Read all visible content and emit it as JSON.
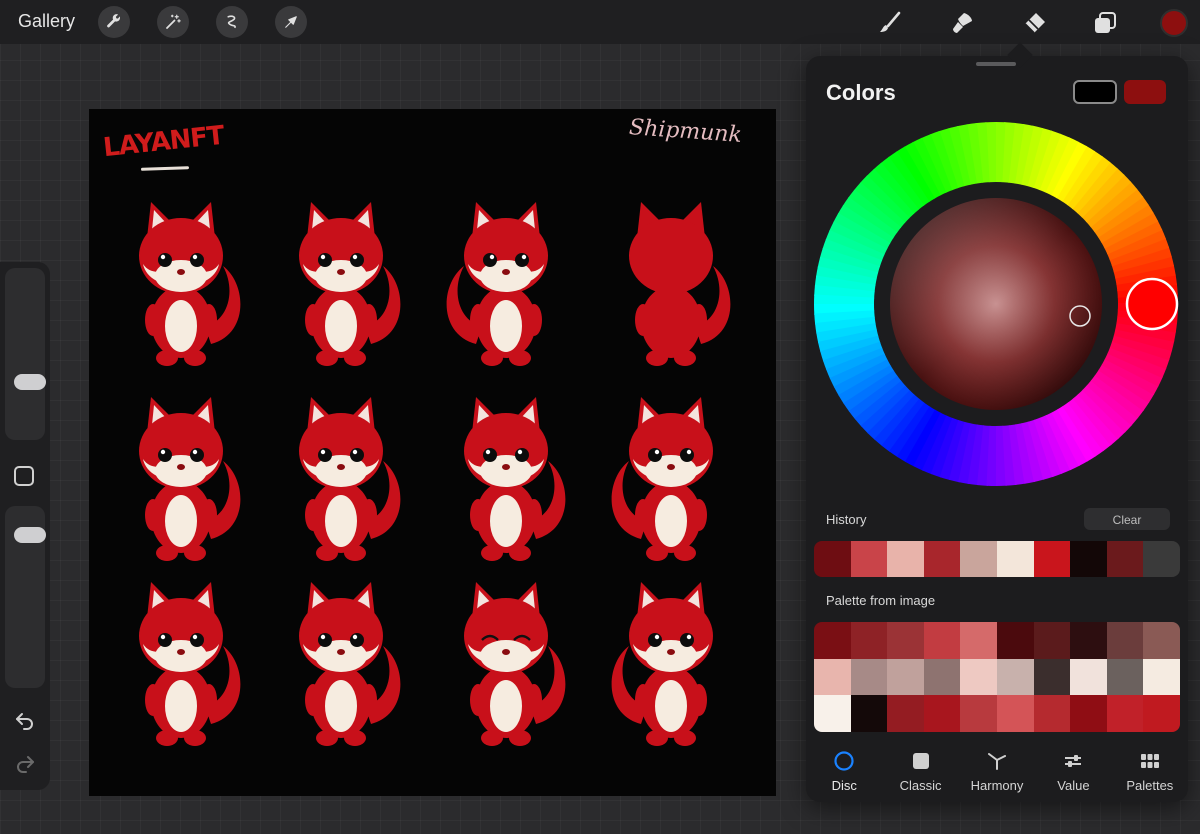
{
  "topbar": {
    "gallery_label": "Gallery",
    "left_tools": [
      "wrench-icon",
      "magic-wand-icon",
      "selection-icon",
      "transform-arrow-icon"
    ],
    "right_tools": [
      "brush-icon",
      "smudge-icon",
      "eraser-icon",
      "layers-icon"
    ],
    "current_color": "#8d0f0f"
  },
  "sidebar": {
    "brush_size_level": 0.3,
    "opacity_level": 0.9,
    "icons": [
      "modify-square-icon",
      "undo-icon",
      "redo-icon"
    ]
  },
  "canvas": {
    "signature_text": "LAYANFT",
    "tag_text": "Shipmunk",
    "character_color": "#c8101a",
    "background": "#050505",
    "rows": 3,
    "columns": 4
  },
  "colors_panel": {
    "title": "Colors",
    "secondary_color": "#000000",
    "primary_color": "#8d0f0f",
    "hue_marker_color": "#ff0000",
    "history_label": "History",
    "clear_label": "Clear",
    "history_colors": [
      "#6e0d12",
      "#c94449",
      "#e8b3aa",
      "#a8262c",
      "#c9a59c",
      "#f3e6da",
      "#c9151c",
      "#130707",
      "#6b1a1c",
      "#3a3a3a"
    ],
    "palette_label": "Palette from image",
    "palette_colors": [
      "#7a0f14",
      "#8e2226",
      "#9b3336",
      "#c23c41",
      "#d56a6a",
      "#4b0a0d",
      "#5b1b1c",
      "#2d0e10",
      "#6b3d3c",
      "#8a5a55",
      "#e8b5ad",
      "#a78a87",
      "#c0a19c",
      "#8e7370",
      "#eec9c2",
      "#c8b1ac",
      "#3b2e2d",
      "#f1e2dc",
      "#6b615e",
      "#f5ebe1",
      "#f8f1ea",
      "#140909",
      "#941c22",
      "#a8161e",
      "#b83a3e",
      "#d45457",
      "#b52a2f",
      "#8f0d14",
      "#c12129",
      "#c01a20"
    ],
    "tabs": [
      {
        "label": "Disc",
        "icon": "disc-icon"
      },
      {
        "label": "Classic",
        "icon": "classic-square-icon"
      },
      {
        "label": "Harmony",
        "icon": "harmony-icon"
      },
      {
        "label": "Value",
        "icon": "value-sliders-icon"
      },
      {
        "label": "Palettes",
        "icon": "palettes-grid-icon"
      }
    ],
    "active_tab": "Disc"
  }
}
